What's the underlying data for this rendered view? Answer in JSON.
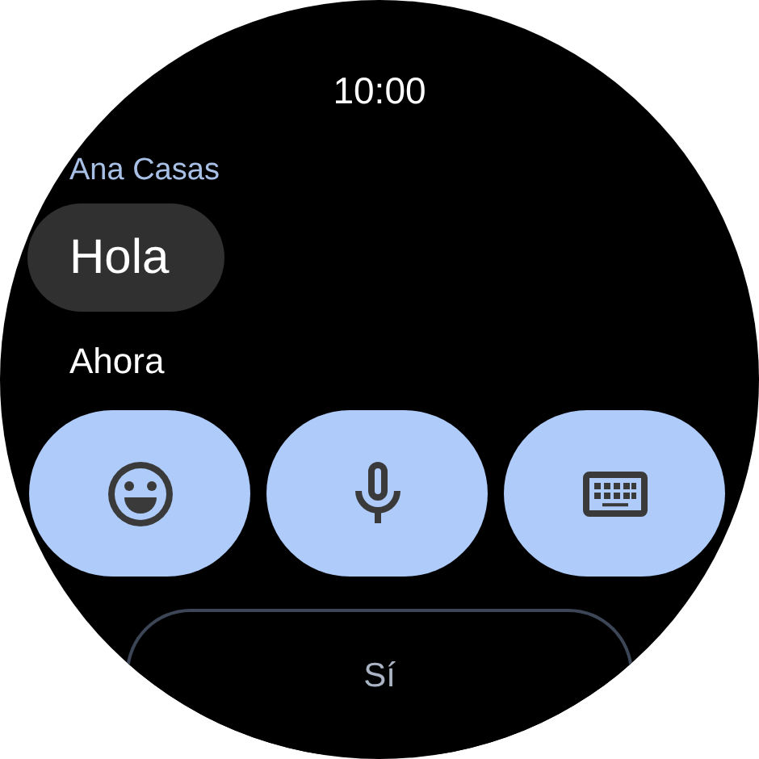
{
  "status": {
    "time": "10:00"
  },
  "conversation": {
    "sender": "Ana Casas",
    "message": "Hola",
    "timestamp": "Ahora"
  },
  "input_buttons": [
    {
      "kind": "emoji"
    },
    {
      "kind": "voice"
    },
    {
      "kind": "keyboard"
    }
  ],
  "quick_replies": [
    "Sí"
  ]
}
